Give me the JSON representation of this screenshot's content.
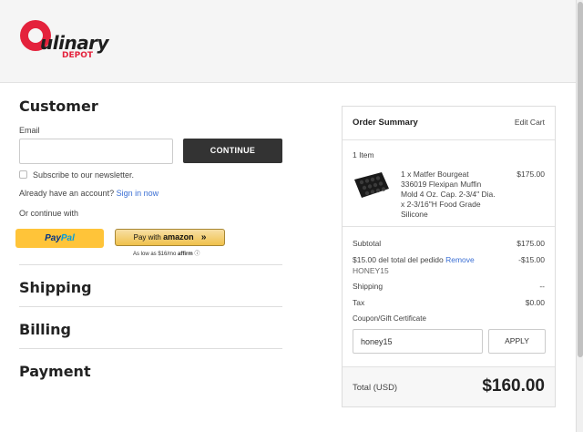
{
  "logo": {
    "name": "ulinary",
    "sub": "DEPOT"
  },
  "customer": {
    "heading": "Customer",
    "email_label": "Email",
    "email_value": "",
    "continue_label": "CONTINUE",
    "newsletter_label": "Subscribe to our newsletter.",
    "account_text": "Already have an account?",
    "signin_link": "Sign in now",
    "continue_with": "Or continue with",
    "paypal_pay": "Pay",
    "paypal_pal": "Pal",
    "amazon_prefix": "Pay with",
    "amazon_brand": "amazon",
    "amazon_arrow": "»",
    "affirm_note": "As low as $16/mo",
    "affirm_brand": "affirm",
    "affirm_info": "ⓘ"
  },
  "sections": {
    "shipping": "Shipping",
    "billing": "Billing",
    "payment": "Payment"
  },
  "summary": {
    "title": "Order Summary",
    "edit_cart": "Edit Cart",
    "item_count": "1 Item",
    "product_desc": "1 x Matfer Bourgeat 336019 Flexipan Muffin Mold 4 Oz. Cap. 2-3/4\" Dia. x 2-3/16\"H Food Grade Silicone",
    "product_price": "$175.00",
    "subtotal_label": "Subtotal",
    "subtotal_value": "$175.00",
    "discount_label": "$15.00 del total del pedido",
    "discount_remove": "Remove",
    "discount_value": "-$15.00",
    "discount_code": "HONEY15",
    "shipping_label": "Shipping",
    "shipping_value": "--",
    "tax_label": "Tax",
    "tax_value": "$0.00",
    "coupon_link": "Coupon/Gift Certificate",
    "coupon_value": "honey15",
    "apply_label": "APPLY",
    "total_label": "Total (USD)",
    "total_value": "$160.00"
  },
  "colors": {
    "brand_red": "#e4223c",
    "link_blue": "#3b6fd4",
    "paypal_yellow": "#ffc439",
    "button_dark": "#333333"
  }
}
